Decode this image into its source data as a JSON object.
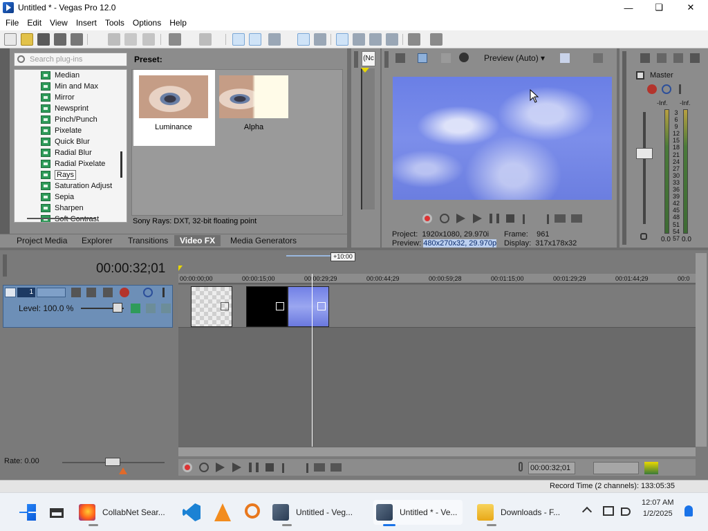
{
  "window": {
    "title": "Untitled * - Vegas Pro 12.0"
  },
  "menu": [
    "File",
    "Edit",
    "View",
    "Insert",
    "Tools",
    "Options",
    "Help"
  ],
  "plugin_chooser": {
    "search_placeholder": "Search plug-ins",
    "items": [
      "Median",
      "Min and Max",
      "Mirror",
      "Newsprint",
      "Pinch/Punch",
      "Pixelate",
      "Quick Blur",
      "Radial Blur",
      "Radial Pixelate",
      "Rays",
      "Saturation Adjust",
      "Sepia",
      "Sharpen",
      "Soft Contrast"
    ],
    "selected": "Rays",
    "preset_label": "Preset:",
    "presets": [
      "Luminance",
      "Alpha"
    ],
    "description": "Sony Rays: DXT, 32-bit floating point"
  },
  "dock_tabs": [
    "Project Media",
    "Explorer",
    "Transitions",
    "Video FX",
    "Media Generators"
  ],
  "active_tab": "Video FX",
  "trimmer_label": "(Nc",
  "preview": {
    "mode": "Preview (Auto)",
    "project_label": "Project:",
    "project_value": "1920x1080, 29.970i",
    "frame_label": "Frame:",
    "frame_value": "961",
    "preview_label": "Preview:",
    "preview_value": "480x270x32, 29.970p",
    "display_label": "Display:",
    "display_value": "317x178x32"
  },
  "master": {
    "title": "Master",
    "left_peak": "-Inf.",
    "right_peak": "-Inf.",
    "scale": [
      "3",
      "6",
      "9",
      "12",
      "15",
      "18",
      "21",
      "24",
      "27",
      "30",
      "33",
      "36",
      "39",
      "42",
      "45",
      "48",
      "51",
      "54",
      "57"
    ],
    "left_level": "0.0",
    "right_level": "0.0"
  },
  "timeline": {
    "timecode": "00:00:32;01",
    "zoom_label": "+10:00",
    "ruler": [
      "00:00:00;00",
      "00:00:15;00",
      "00:00:29;29",
      "00:00:44;29",
      "00:00:59;28",
      "00:01:15;00",
      "00:01:29;29",
      "00:01:44;29",
      "00:0"
    ],
    "track_number": "1",
    "level_label": "Level: 100.0 %",
    "rate_label": "Rate: 0.00",
    "cursor_timecode": "00:00:32;01",
    "record_time": "Record Time (2 channels): 133:05:35"
  },
  "taskbar": {
    "items": [
      "CollabNet Sear...",
      "Untitled - Veg...",
      "Untitled * - Ve...",
      "Downloads - F..."
    ],
    "time": "12:07 AM",
    "date": "1/2/2025"
  }
}
